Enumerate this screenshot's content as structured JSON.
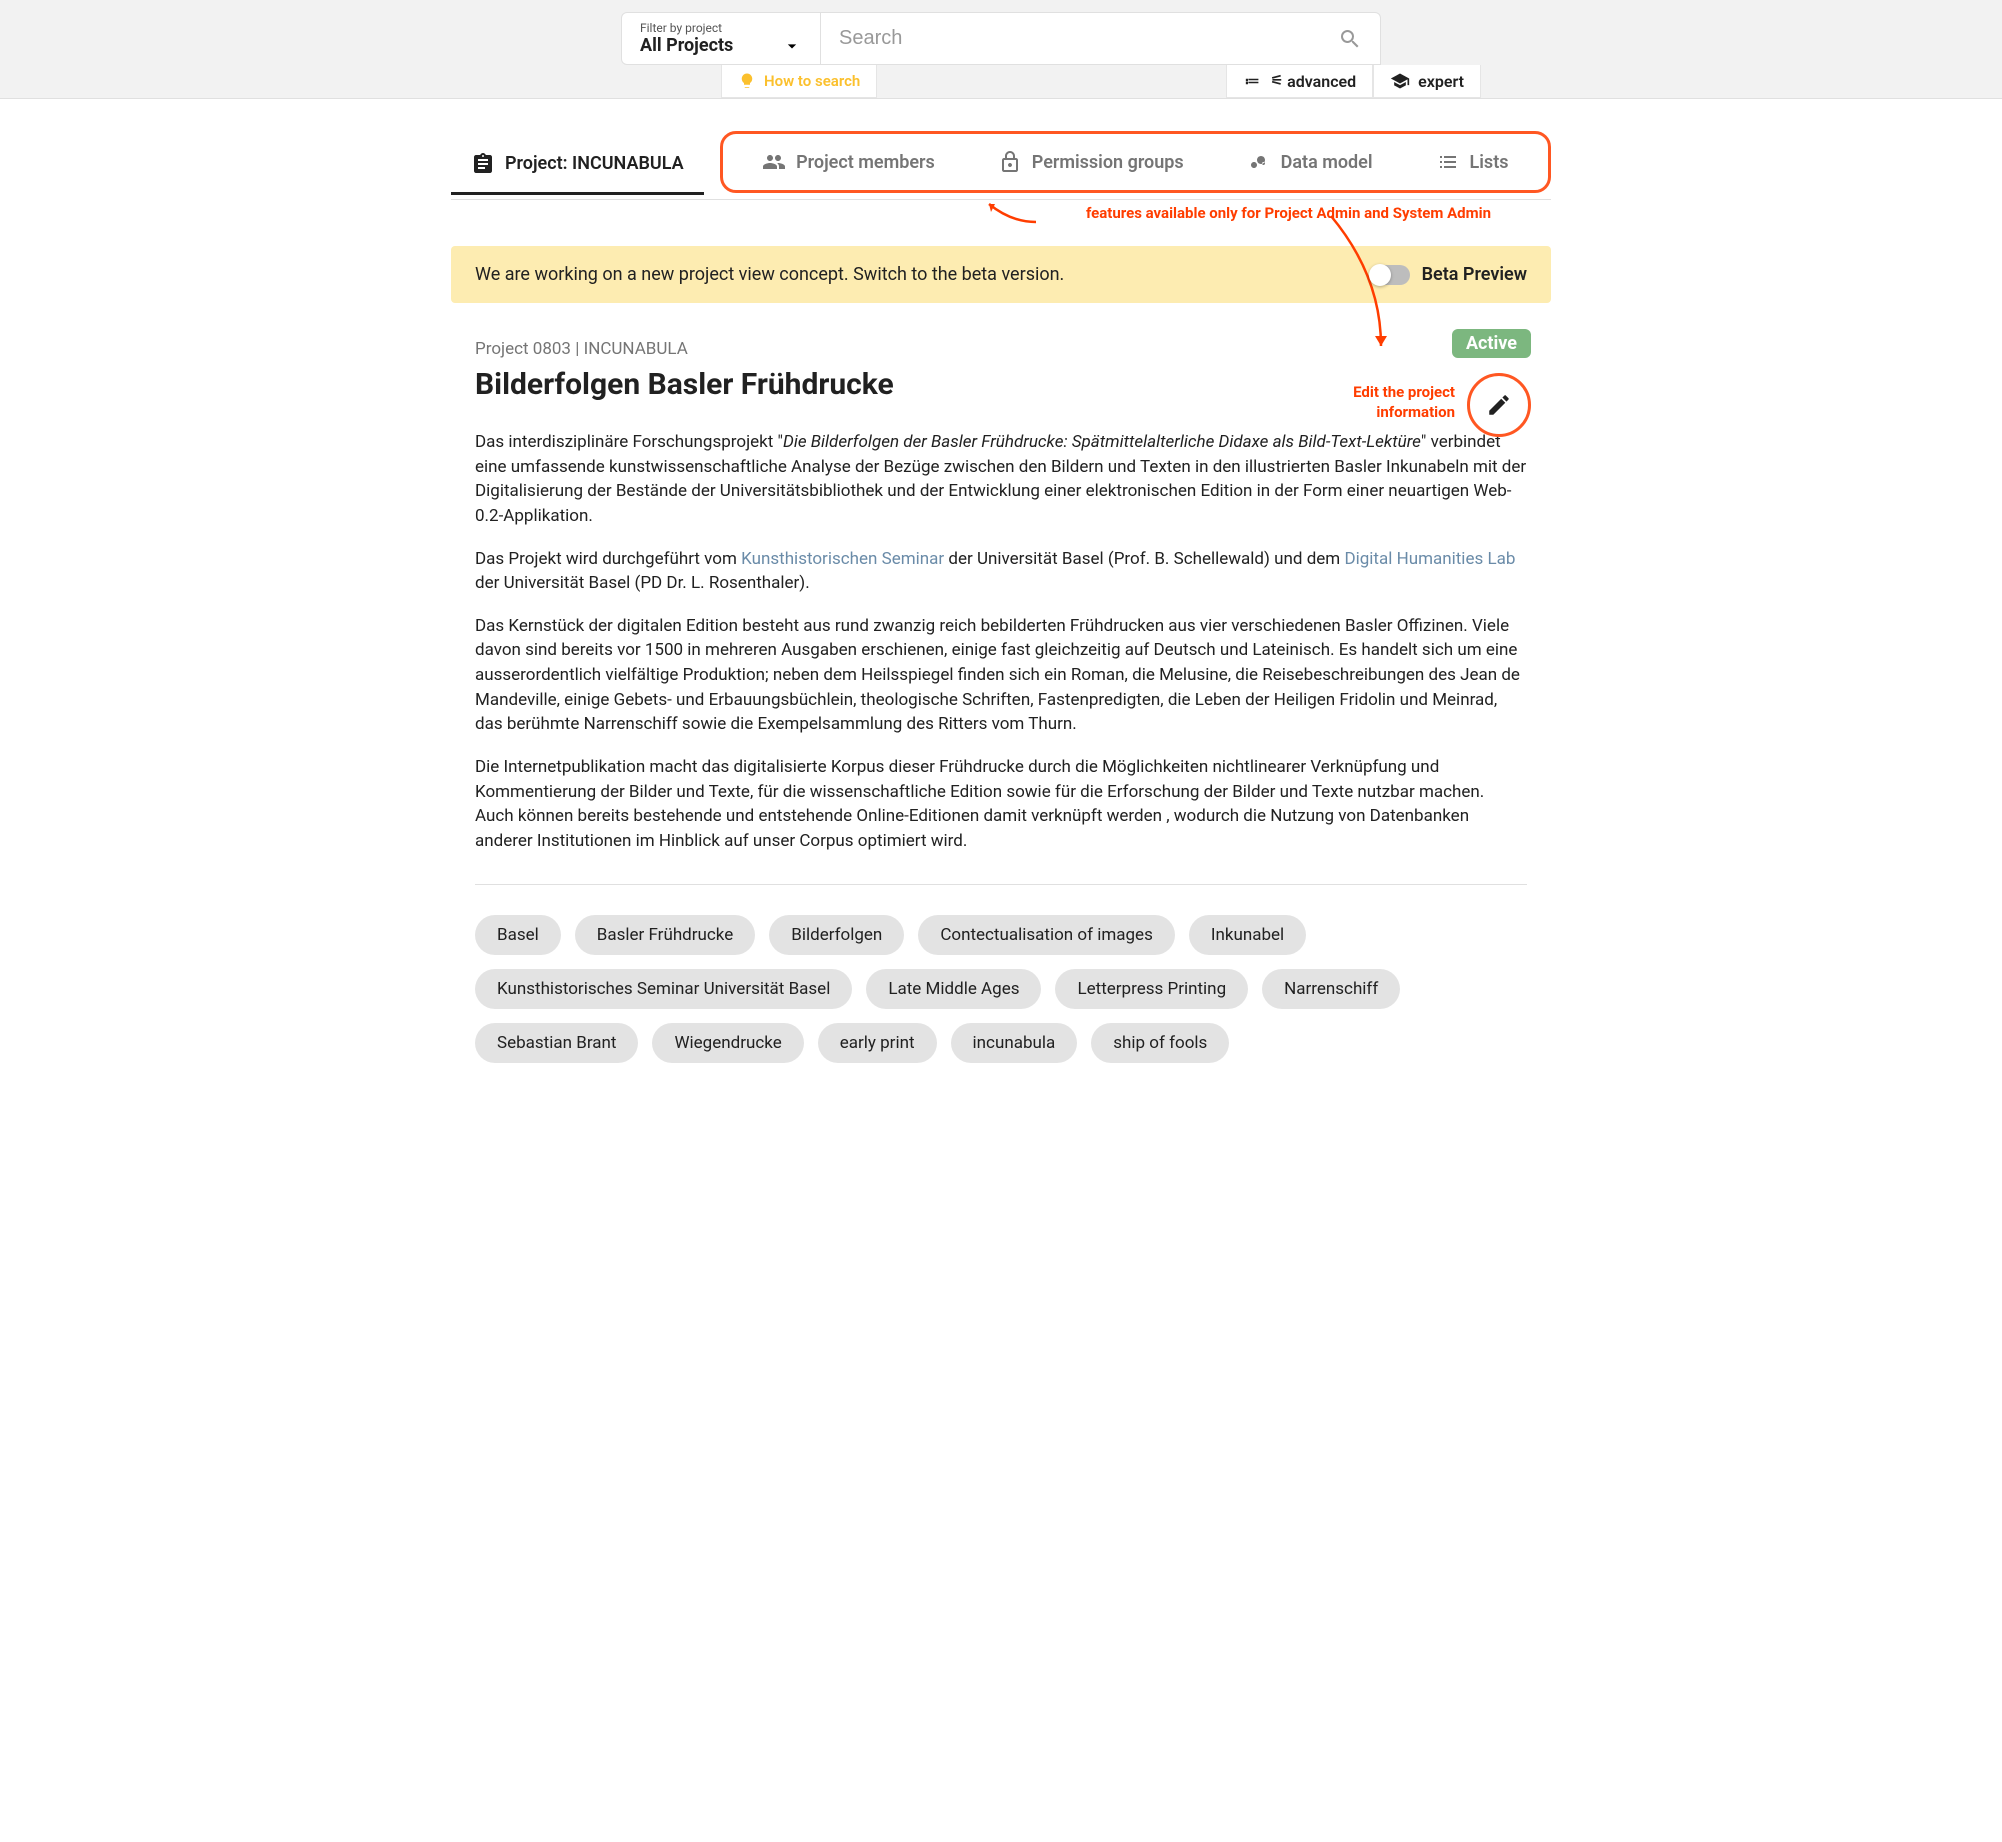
{
  "topbar": {
    "filter_label": "Filter by project",
    "filter_value": "All Projects",
    "search_placeholder": "Search",
    "howto_label": "How to search",
    "advanced_label": "advanced",
    "expert_label": "expert"
  },
  "tabs": {
    "project_label": "Project: INCUNABULA",
    "members_label": "Project members",
    "permissions_label": "Permission groups",
    "datamodel_label": "Data model",
    "lists_label": "Lists"
  },
  "annotations": {
    "admin_features": "features available only for Project Admin and System Admin",
    "edit_project_line1": "Edit the project",
    "edit_project_line2": "information"
  },
  "banner": {
    "text": "We are working on a new project view concept. Switch to the beta version.",
    "toggle_label": "Beta Preview"
  },
  "project": {
    "meta": "Project 0803 | INCUNABULA",
    "title": "Bilderfolgen Basler Frühdrucke",
    "status": "Active"
  },
  "description": {
    "p1_prefix": "Das interdisziplinäre Forschungsprojekt \"",
    "p1_italic": "Die Bilderfolgen der Basler Frühdrucke: Spätmittelalterliche Didaxe als Bild-Text-Lektüre",
    "p1_suffix": "\" verbindet eine umfassende kunstwissenschaftliche Analyse der Bezüge zwischen den Bildern und Texten in den illustrierten Basler Inkunabeln mit der Digitalisierung der Bestände der Universitätsbibliothek und der Entwicklung einer elektronischen Edition in der Form einer neuartigen Web-0.2-Applikation.",
    "p2_a": "Das Projekt wird durchgeführt vom ",
    "p2_link1": "Kunsthistorischen Seminar",
    "p2_b": " der Universität Basel (Prof. B. Schellewald) und dem ",
    "p2_link2": "Digital Humanities Lab",
    "p2_c": " der Universität Basel (PD Dr. L. Rosenthaler).",
    "p3": "Das Kernstück der digitalen Edition besteht aus rund zwanzig reich bebilderten Frühdrucken aus vier verschiedenen Basler Offizinen. Viele davon sind bereits vor 1500 in mehreren Ausgaben erschienen, einige fast gleichzeitig auf Deutsch und Lateinisch. Es handelt sich um eine ausserordentlich vielfältige Produktion; neben dem Heilsspiegel finden sich ein Roman, die Melusine, die Reisebeschreibungen des Jean de Mandeville, einige Gebets- und Erbauungsbüchlein, theologische Schriften, Fastenpredigten, die Leben der Heiligen Fridolin und Meinrad, das berühmte Narrenschiff sowie die Exempelsammlung des Ritters vom Thurn.",
    "p4": "Die Internetpublikation macht das digitalisierte Korpus dieser Frühdrucke durch die Möglichkeiten nichtlinearer Verknüpfung und Kommentierung der Bilder und Texte, für die wissenschaftliche Edition sowie für die Erforschung der Bilder und Texte nutzbar machen. Auch können bereits bestehende und entstehende Online-Editionen damit verknüpft werden , wodurch die Nutzung von Datenbanken anderer Institutionen im Hinblick auf unser Corpus optimiert wird."
  },
  "tags": [
    "Basel",
    "Basler Frühdrucke",
    "Bilderfolgen",
    "Contectualisation of images",
    "Inkunabel",
    "Kunsthistorisches Seminar Universität Basel",
    "Late Middle Ages",
    "Letterpress Printing",
    "Narrenschiff",
    "Sebastian Brant",
    "Wiegendrucke",
    "early print",
    "incunabula",
    "ship of fools"
  ]
}
